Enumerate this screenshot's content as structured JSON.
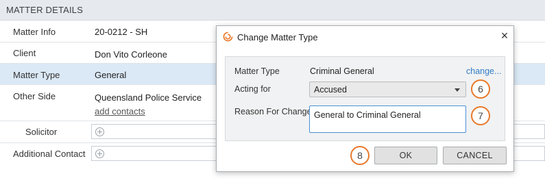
{
  "section": {
    "title": "MATTER DETAILS"
  },
  "fields": {
    "matter_info": {
      "label": "Matter Info",
      "value": "20-0212 - SH"
    },
    "client": {
      "label": "Client",
      "value": "Don Vito Corleone"
    },
    "matter_type": {
      "label": "Matter Type",
      "value": "General"
    },
    "other_side": {
      "label": "Other Side",
      "value": "Queensland Police Service",
      "link": "add contacts"
    },
    "solicitor": {
      "label": "Solicitor"
    },
    "additional_contact": {
      "label": "Additional Contact"
    }
  },
  "dialog": {
    "title": "Change Matter Type",
    "close": "×",
    "matter_type_label": "Matter Type",
    "matter_type_value": "Criminal General",
    "change_link": "change...",
    "acting_for_label": "Acting for",
    "acting_for_value": "Accused",
    "reason_label": "Reason For Change",
    "reason_value": "General to Criminal General",
    "ok": "OK",
    "cancel": "CANCEL"
  },
  "callouts": {
    "six": "6",
    "seven": "7",
    "eight": "8"
  },
  "colors": {
    "accent": "#e8792b",
    "highlight_row": "#dbe9f6",
    "link": "#2f7cc6"
  }
}
